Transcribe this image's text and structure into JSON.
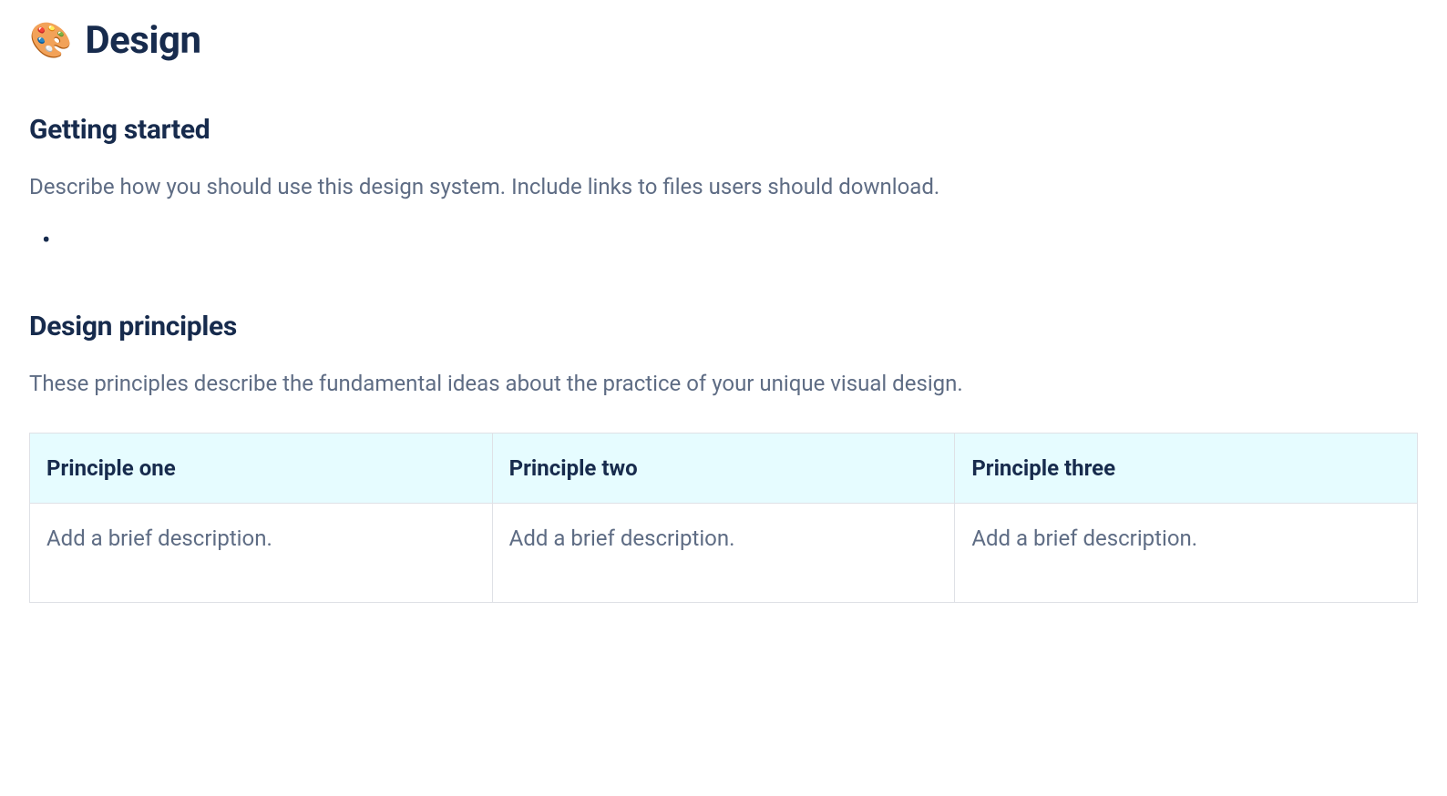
{
  "page": {
    "icon": "🎨",
    "title": "Design"
  },
  "sections": {
    "getting_started": {
      "heading": "Getting started",
      "description": "Describe how you should use this design system. Include links to files users should download.",
      "bullets": [
        ""
      ]
    },
    "design_principles": {
      "heading": "Design principles",
      "description": "These principles describe the fundamental ideas about the practice of your unique visual design.",
      "table": {
        "headers": [
          "Principle one",
          "Principle two",
          "Principle three"
        ],
        "row": [
          "Add a brief description.",
          "Add a brief description.",
          "Add a brief description."
        ]
      }
    }
  }
}
